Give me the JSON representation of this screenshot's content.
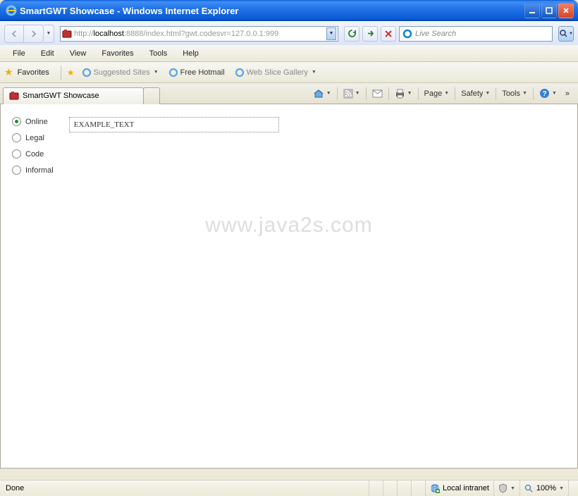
{
  "window": {
    "title": "SmartGWT Showcase - Windows Internet Explorer"
  },
  "nav": {
    "url_gray_prefix": "http://",
    "url_host": "localhost",
    "url_gray_suffix": ":8888/index.html?gwt.codesvr=127.0.0.1:999",
    "search_placeholder": "Live Search"
  },
  "menu": {
    "items": [
      "File",
      "Edit",
      "View",
      "Favorites",
      "Tools",
      "Help"
    ]
  },
  "favbar": {
    "favorites_label": "Favorites",
    "suggested": "Suggested Sites",
    "hotmail": "Free Hotmail",
    "webslice": "Web Slice Gallery"
  },
  "tabs": {
    "active": "SmartGWT Showcase"
  },
  "cmdbar": {
    "page": "Page",
    "safety": "Safety",
    "tools": "Tools"
  },
  "content": {
    "radios": [
      "Online",
      "Legal",
      "Code",
      "Informal"
    ],
    "selected_index": 0,
    "textbox_value": "EXAMPLE_TEXT",
    "watermark": "www.java2s.com"
  },
  "status": {
    "left": "Done",
    "zone": "Local intranet",
    "zoom": "100%"
  }
}
